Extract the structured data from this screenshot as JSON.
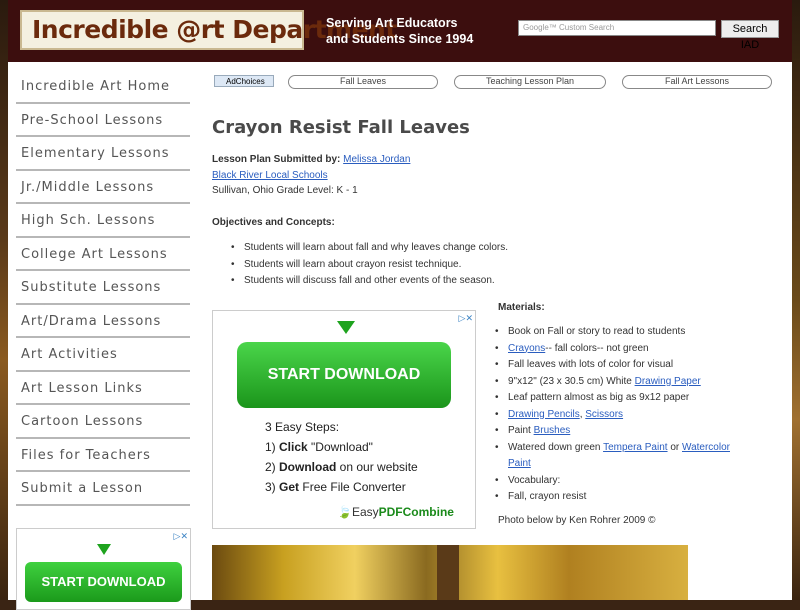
{
  "header": {
    "logo_text": "Incredible @rt Department",
    "tagline_line1": "Serving Art Educators",
    "tagline_line2": "and Students Since 1994",
    "search_placeholder": "Google™ Custom Search",
    "search_button": "Search IAD"
  },
  "sidebar": {
    "items": [
      {
        "label": "Incredible Art Home"
      },
      {
        "label": "Pre-School Lessons"
      },
      {
        "label": "Elementary Lessons"
      },
      {
        "label": "Jr./Middle Lessons"
      },
      {
        "label": "High Sch. Lessons"
      },
      {
        "label": "College Art Lessons"
      },
      {
        "label": "Substitute Lessons"
      },
      {
        "label": "Art/Drama Lessons"
      },
      {
        "label": "Art Activities"
      },
      {
        "label": "Art Lesson Links"
      },
      {
        "label": "Cartoon Lessons"
      },
      {
        "label": "Files for Teachers"
      },
      {
        "label": "Submit a Lesson"
      }
    ],
    "ad_button": "START DOWNLOAD"
  },
  "toplinks": {
    "adchoices": "AdChoices",
    "links": [
      "Fall Leaves",
      "Teaching Lesson Plan",
      "Fall Art Lessons"
    ]
  },
  "article": {
    "title": "Crayon Resist Fall Leaves",
    "submitted_label": "Lesson Plan Submitted by:",
    "author": "Melissa Jordan",
    "school": "Black River Local Schools",
    "location": "Sullivan, Ohio Grade Level: K - 1",
    "objectives_heading": "Objectives and Concepts:",
    "objectives": [
      "Students will learn about fall and why leaves change colors.",
      "Students will learn about crayon resist technique.",
      "Students will discuss fall and other events of the season."
    ],
    "materials_heading": "Materials:",
    "materials": [
      {
        "pre": "Book on Fall or story to read to students",
        "link": "",
        "post": ""
      },
      {
        "pre": "",
        "link": "Crayons",
        "post": "-- fall colors-- not green"
      },
      {
        "pre": "Fall leaves with lots of color for visual",
        "link": "",
        "post": ""
      },
      {
        "pre": "9\"x12\" (23 x 30.5 cm) White ",
        "link": "Drawing Paper",
        "post": ""
      },
      {
        "pre": "Leaf pattern almost as big as 9x12 paper",
        "link": "",
        "post": ""
      },
      {
        "pre": "",
        "link": "Drawing Pencils",
        "post": ", ",
        "link2": "Scissors"
      },
      {
        "pre": "Paint ",
        "link": "Brushes",
        "post": ""
      },
      {
        "pre": "Watered down green ",
        "link": "Tempera Paint",
        "post": " or ",
        "link2": "Watercolor Paint"
      },
      {
        "pre": "Vocabulary:",
        "link": "",
        "post": ""
      },
      {
        "pre": "Fall, crayon resist",
        "link": "",
        "post": ""
      }
    ],
    "photo_credit": "Photo below by Ken Rohrer 2009 ©"
  },
  "big_ad": {
    "button": "START DOWNLOAD",
    "steps_title": "3 Easy Steps:",
    "step1_num": "1) ",
    "step1_bold": "Click",
    "step1_rest": " \"Download\"",
    "step2_num": "2) ",
    "step2_bold": "Download",
    "step2_rest": " on our website",
    "step3_num": "3) ",
    "step3_bold": "Get",
    "step3_rest": " Free File Converter",
    "brand_prefix": "Easy",
    "brand_suffix": "PDFCombine",
    "close": "▷✕"
  }
}
